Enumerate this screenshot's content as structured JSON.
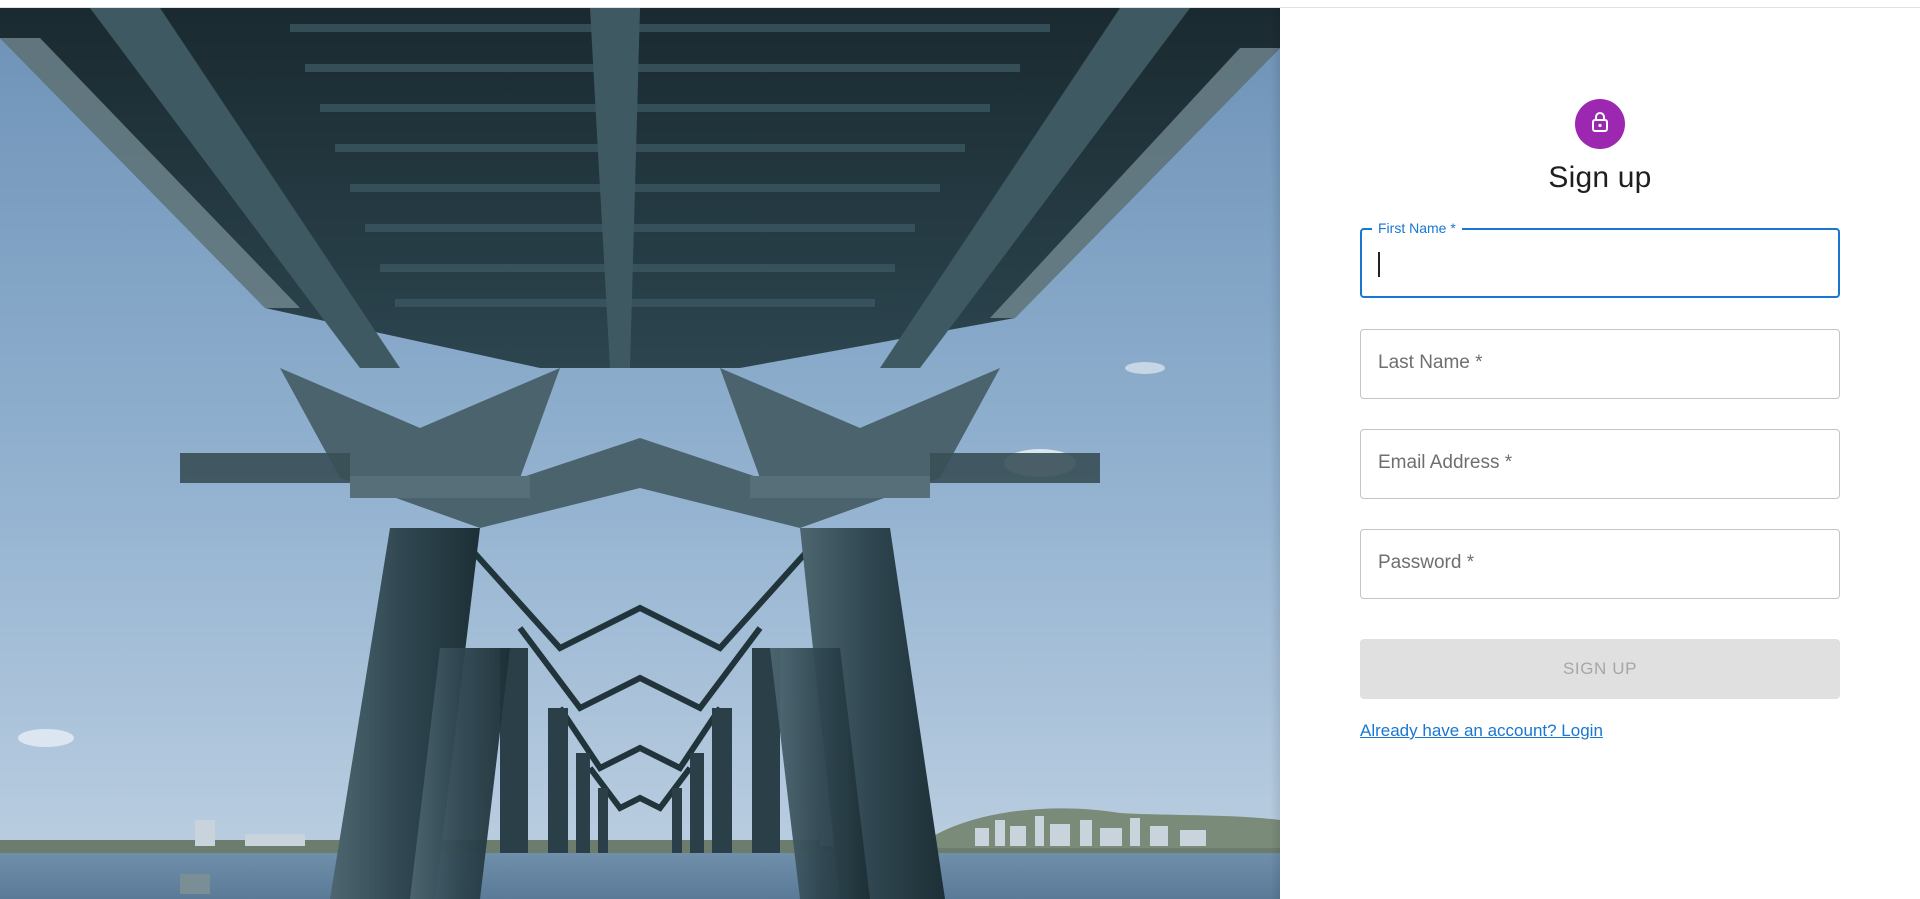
{
  "hero": {
    "image_name": "bridge-underside-photo"
  },
  "form": {
    "icon": "lock-icon",
    "title": "Sign up",
    "fields": {
      "first_name": {
        "label": "First Name *",
        "value": ""
      },
      "last_name": {
        "placeholder": "Last Name *"
      },
      "email": {
        "placeholder": "Email Address *"
      },
      "password": {
        "placeholder": "Password *"
      }
    },
    "submit_label": "SIGN UP",
    "login_link": "Already have an account? Login"
  },
  "colors": {
    "accent": "#1976d2",
    "avatar": "#9c27b0",
    "button_disabled_bg": "#e0e0e0",
    "button_disabled_text": "#a6a6a6"
  }
}
